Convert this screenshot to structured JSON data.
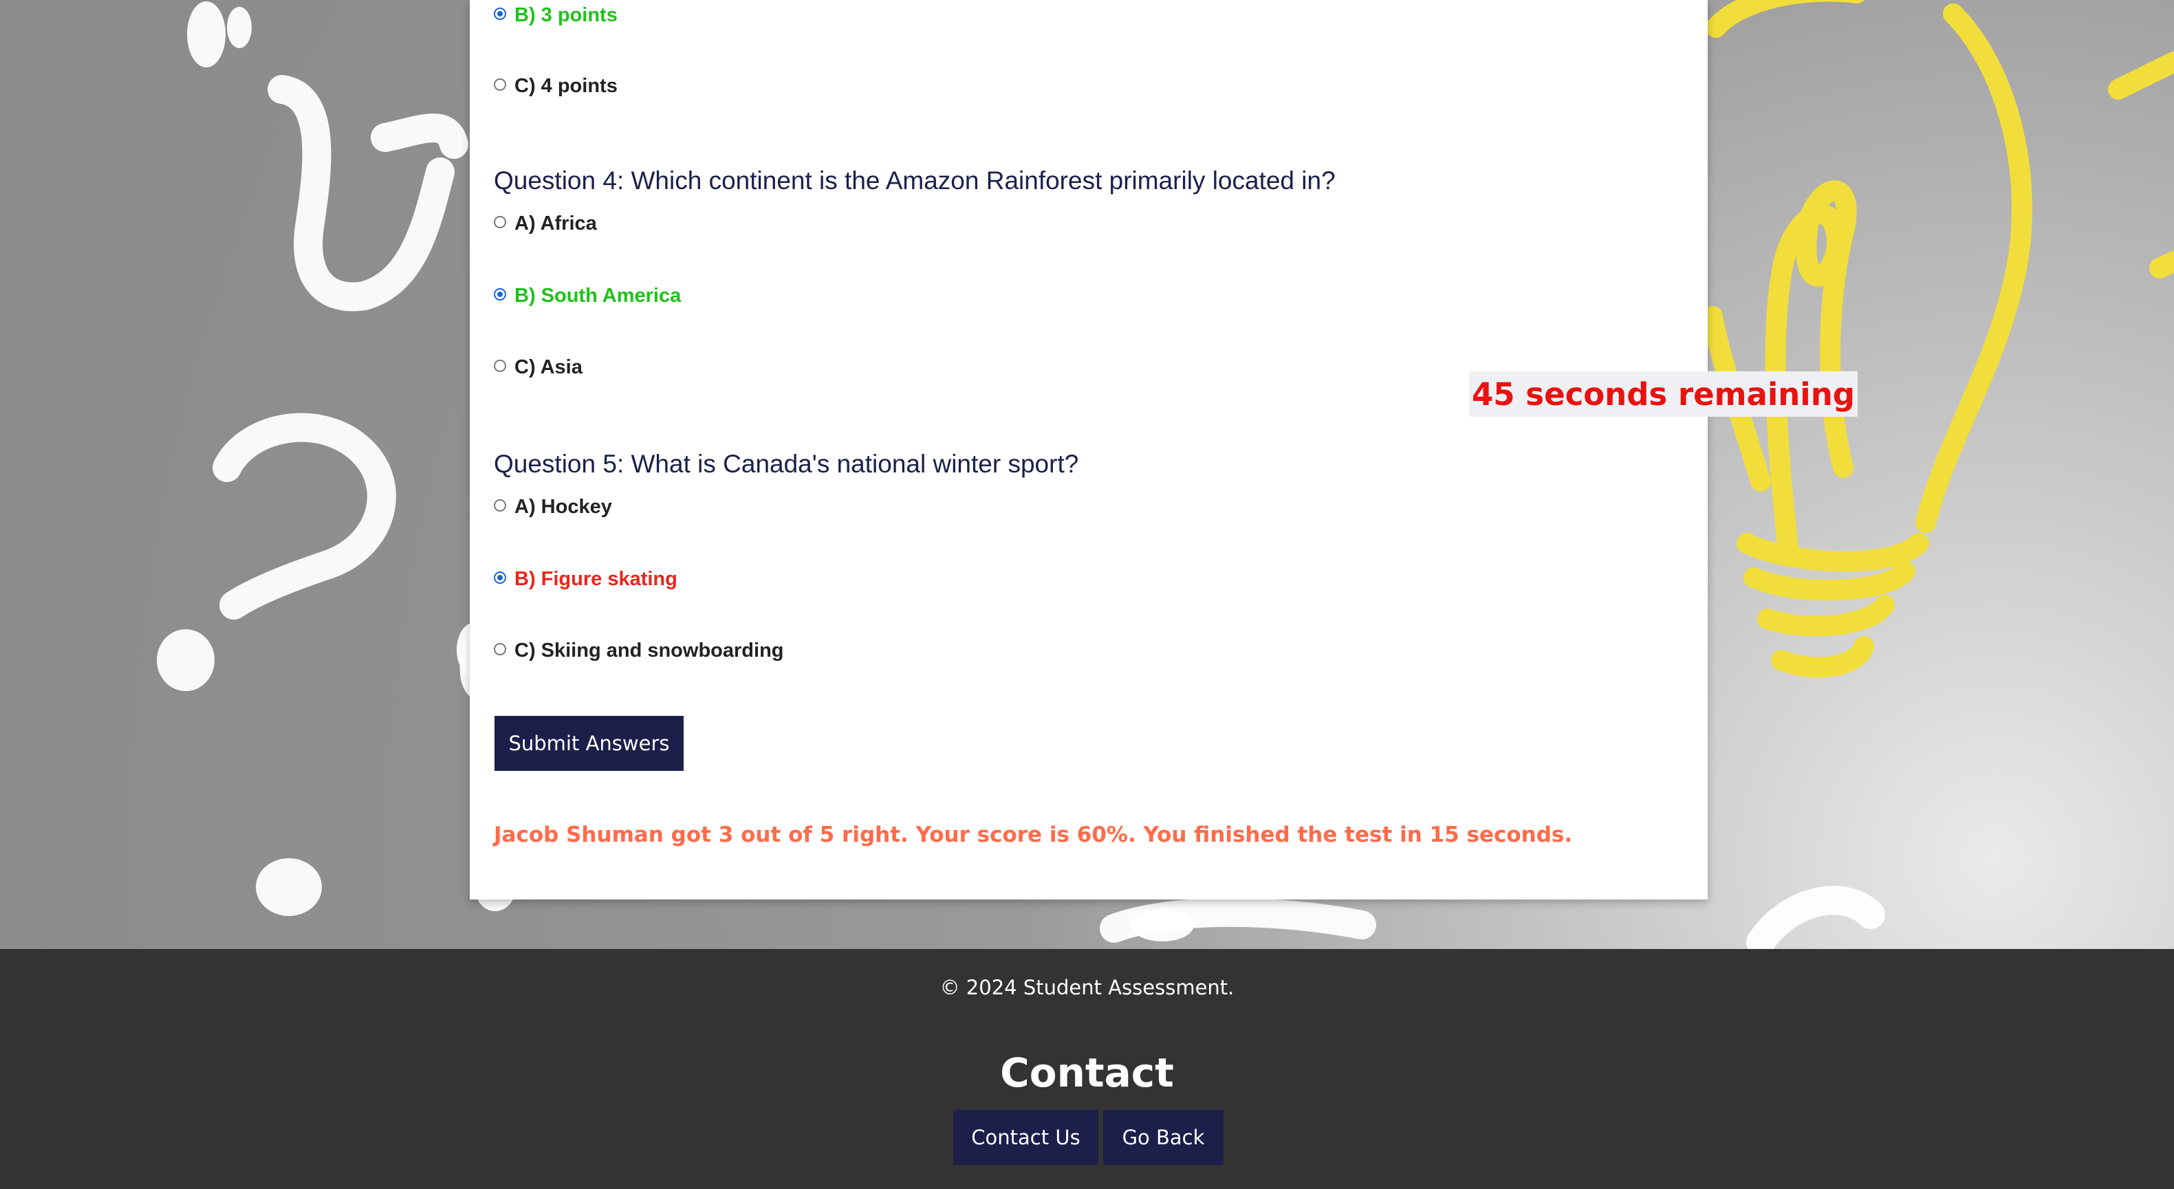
{
  "quiz": {
    "q3_options": [
      {
        "label": "B) 3 points",
        "checked": true,
        "state": "correct"
      },
      {
        "label": "C) 4 points",
        "checked": false,
        "state": "neutral"
      }
    ],
    "q4": {
      "question": "Question 4: Which continent is the Amazon Rainforest primarily located in?",
      "options": [
        {
          "label": "A) Africa",
          "checked": false,
          "state": "neutral"
        },
        {
          "label": "B) South America",
          "checked": true,
          "state": "correct"
        },
        {
          "label": "C) Asia",
          "checked": false,
          "state": "neutral"
        }
      ]
    },
    "q5": {
      "question": "Question 5: What is Canada's national winter sport?",
      "options": [
        {
          "label": "A) Hockey",
          "checked": false,
          "state": "neutral"
        },
        {
          "label": "B) Figure skating",
          "checked": true,
          "state": "wrong"
        },
        {
          "label": "C) Skiing and snowboarding",
          "checked": false,
          "state": "neutral"
        }
      ]
    },
    "submit_label": "Submit Answers",
    "result_text": "Jacob Shuman got 3 out of 5 right. Your score is 60%. You finished the test in 15 seconds.",
    "timer_text": "45 seconds remaining"
  },
  "footer": {
    "copyright": "© 2024 Student Assessment.",
    "contact_title": "Contact",
    "contact_button": "Contact Us",
    "back_button": "Go Back"
  },
  "colors": {
    "correct": "#1fc21a",
    "wrong": "#e8261c",
    "navy": "#1c1f4a",
    "result": "#ff6b4a",
    "timer": "#e8120f",
    "footer_bg": "#333333"
  }
}
